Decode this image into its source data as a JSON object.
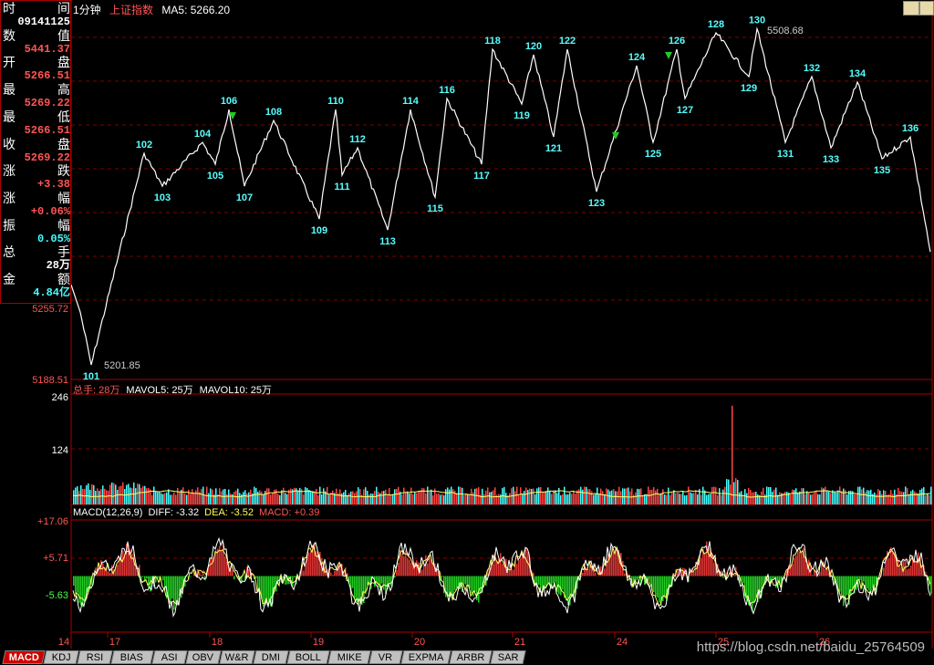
{
  "header": {
    "period": "1分钟",
    "index_name": "上证指数",
    "ma_label": "MA5: 5266.20"
  },
  "info_panel": {
    "rows": [
      {
        "label": "时",
        "label2": "间",
        "value": "09141125",
        "color": "white"
      },
      {
        "label": "数",
        "label2": "值",
        "value": "5441.37",
        "color": "red"
      },
      {
        "label": "开",
        "label2": "盘",
        "value": "5266.51",
        "color": "red"
      },
      {
        "label": "最",
        "label2": "高",
        "value": "5269.22",
        "color": "red"
      },
      {
        "label": "最",
        "label2": "低",
        "value": "5266.51",
        "color": "red"
      },
      {
        "label": "收",
        "label2": "盘",
        "value": "5269.22",
        "color": "red"
      },
      {
        "label": "涨",
        "label2": "跌",
        "value": "+3.38",
        "color": "red"
      },
      {
        "label": "涨",
        "label2": "幅",
        "value": "+0.06%",
        "color": "red"
      },
      {
        "label": "振",
        "label2": "幅",
        "value": "0.05%",
        "color": "cyan"
      },
      {
        "label": "总",
        "label2": "手",
        "value": "28万",
        "color": "white"
      },
      {
        "label": "金",
        "label2": "额",
        "value": "4.84亿",
        "color": "cyan"
      }
    ]
  },
  "price_axis_labels": [
    "5255.72",
    "5188.51"
  ],
  "price_extremes": {
    "high": "5508.68",
    "low": "5201.85"
  },
  "volume_header": {
    "total": "总手: 28万",
    "mavol5": "MAVOL5: 25万",
    "mavol10": "MAVOL10: 25万"
  },
  "volume_axis_labels": [
    "246",
    "124"
  ],
  "macd_header": {
    "title": "MACD(12,26,9)",
    "diff": "DIFF: -3.32",
    "dea": "DEA: -3.52",
    "macd": "MACD: +0.39"
  },
  "macd_axis_labels": [
    "+17.06",
    "+5.71",
    "-5.63"
  ],
  "date_labels": [
    "14",
    "17",
    "18",
    "19",
    "20",
    "21",
    "24",
    "25",
    "26"
  ],
  "tabs": [
    "MACD",
    "KDJ",
    "RSI",
    "BIAS",
    "ASI",
    "OBV",
    "W&R",
    "DMI",
    "BOLL",
    "MIKE",
    "VR",
    "EXPMA",
    "ARBR",
    "SAR"
  ],
  "watermark": "https://blog.csdn.net/baidu_25764509",
  "colors": {
    "up": "#ff4444",
    "down": "#44ffff",
    "price_line": "#ffffff",
    "wave_label": "#55ffff",
    "grid": "#800000",
    "macd_pos": "#dd3333",
    "macd_neg": "#22cc22",
    "diff": "#ffffff",
    "dea": "#ffff66"
  },
  "chart_data": {
    "type": "line",
    "x": [
      "14",
      "17",
      "18",
      "19",
      "20",
      "21",
      "24",
      "25",
      "26"
    ],
    "wave_points": [
      {
        "label": "101",
        "value": 5201.85
      },
      {
        "label": "102",
        "value": 5395
      },
      {
        "label": "103",
        "value": 5365
      },
      {
        "label": "104",
        "value": 5405
      },
      {
        "label": "105",
        "value": 5385
      },
      {
        "label": "106",
        "value": 5435
      },
      {
        "label": "107",
        "value": 5365
      },
      {
        "label": "108",
        "value": 5425
      },
      {
        "label": "109",
        "value": 5335
      },
      {
        "label": "110",
        "value": 5435
      },
      {
        "label": "111",
        "value": 5375
      },
      {
        "label": "112",
        "value": 5400
      },
      {
        "label": "113",
        "value": 5325
      },
      {
        "label": "114",
        "value": 5435
      },
      {
        "label": "115",
        "value": 5355
      },
      {
        "label": "116",
        "value": 5445
      },
      {
        "label": "117",
        "value": 5385
      },
      {
        "label": "118",
        "value": 5490
      },
      {
        "label": "119",
        "value": 5440
      },
      {
        "label": "120",
        "value": 5485
      },
      {
        "label": "121",
        "value": 5410
      },
      {
        "label": "122",
        "value": 5490
      },
      {
        "label": "123",
        "value": 5360
      },
      {
        "label": "124",
        "value": 5475
      },
      {
        "label": "125",
        "value": 5405
      },
      {
        "label": "126",
        "value": 5490
      },
      {
        "label": "127",
        "value": 5445
      },
      {
        "label": "128",
        "value": 5505
      },
      {
        "label": "129",
        "value": 5465
      },
      {
        "label": "130",
        "value": 5508.68
      },
      {
        "label": "131",
        "value": 5405
      },
      {
        "label": "132",
        "value": 5465
      },
      {
        "label": "133",
        "value": 5400
      },
      {
        "label": "134",
        "value": 5460
      },
      {
        "label": "135",
        "value": 5390
      },
      {
        "label": "136",
        "value": 5410
      }
    ],
    "end_value": 5305,
    "ylim": [
      5188.51,
      5520
    ],
    "volume_ylim": [
      0,
      246
    ],
    "macd_ylim": [
      -17.06,
      17.06
    ]
  }
}
